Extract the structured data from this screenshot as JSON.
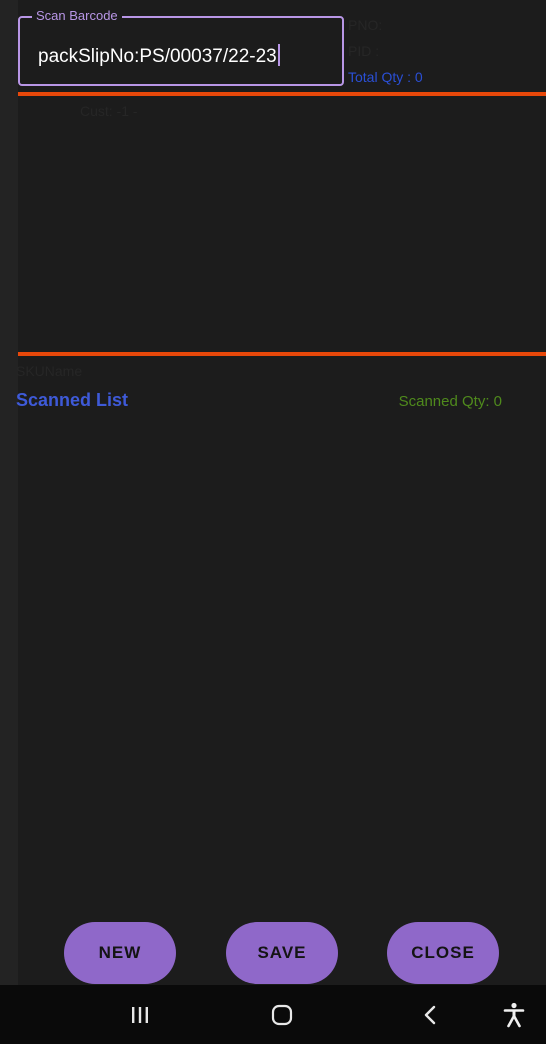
{
  "scan": {
    "legend": "Scan Barcode",
    "value": "packSlipNo:PS/00037/22-23"
  },
  "info": {
    "pno": "PNO:",
    "pid": "PID :",
    "total_qty": "Total Qty  : 0",
    "cust": "Cust: -1 -"
  },
  "list": {
    "sku_name": "SKUName",
    "title": "Scanned List",
    "scanned_qty": "Scanned Qty: 0"
  },
  "actions": {
    "new_label": "NEW",
    "save_label": "SAVE",
    "close_label": "CLOSE"
  },
  "nav": {
    "recents": "recents-icon",
    "home": "home-icon",
    "back": "back-icon",
    "accessibility": "accessibility-icon"
  },
  "colors": {
    "accent": "#b896e6",
    "button": "#8f68c9",
    "divider": "#e8480a",
    "total_qty": "#2a4fd6",
    "scanned_title": "#3e5ad8",
    "scanned_qty": "#4f8a1c"
  }
}
